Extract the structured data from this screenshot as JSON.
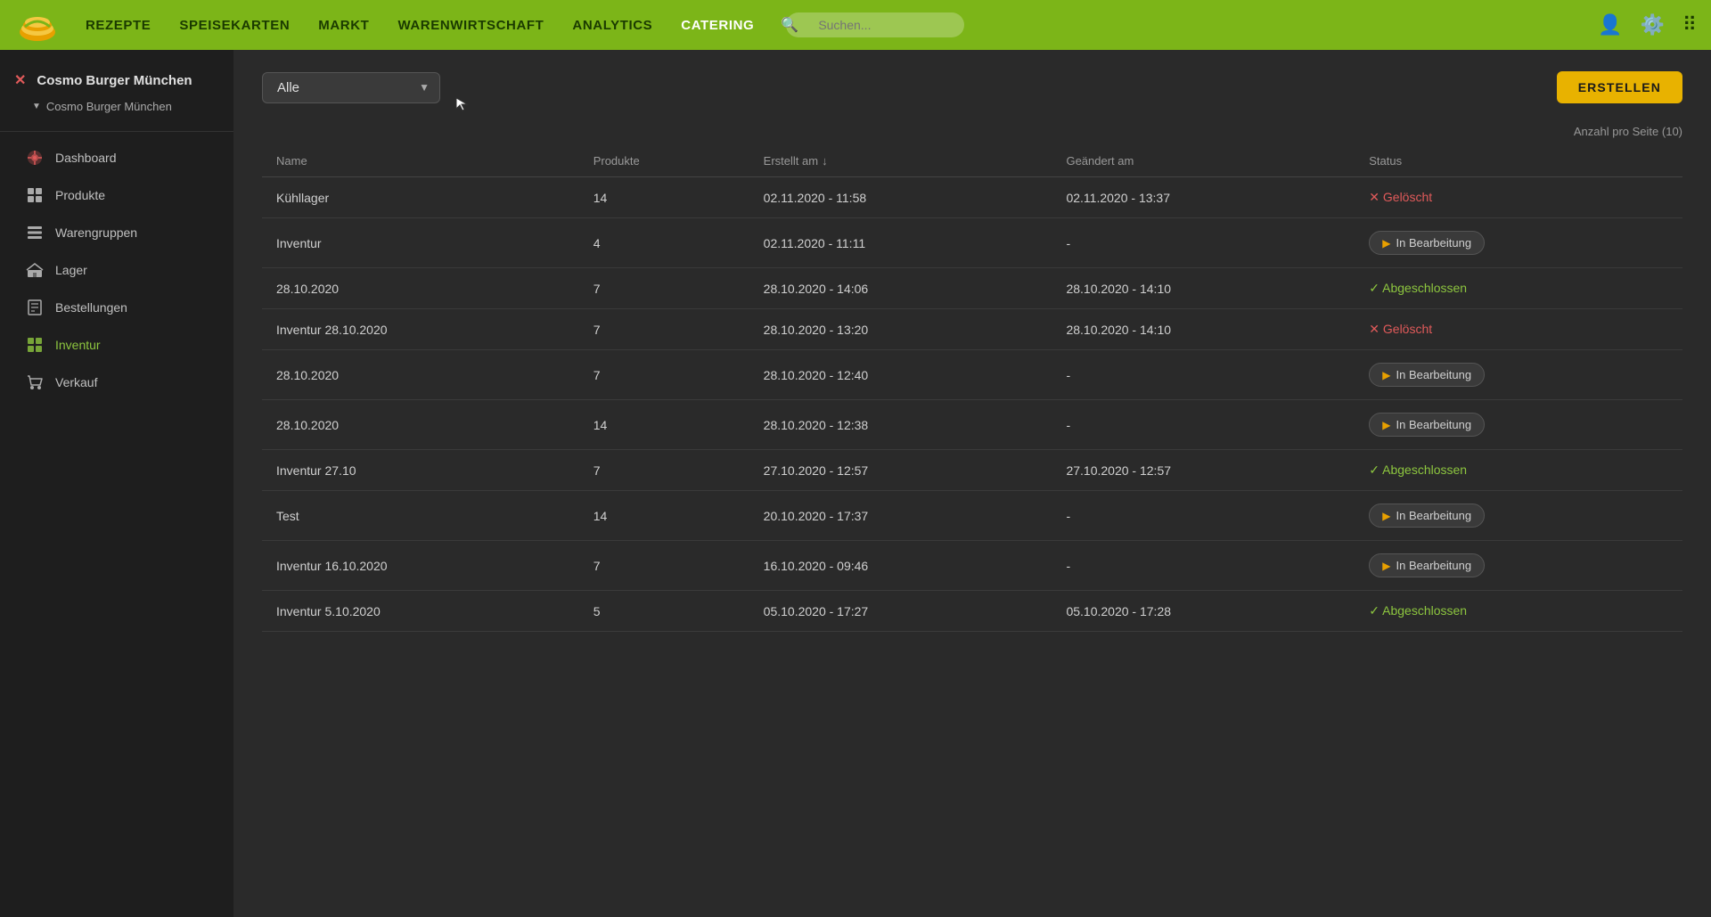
{
  "nav": {
    "items": [
      {
        "label": "REZEPTE",
        "active": false
      },
      {
        "label": "SPEISEKARTEN",
        "active": false
      },
      {
        "label": "MARKT",
        "active": false
      },
      {
        "label": "WARENWIRTSCHAFT",
        "active": false
      },
      {
        "label": "ANALYTICS",
        "active": false
      },
      {
        "label": "CATERING",
        "active": false
      }
    ],
    "search_placeholder": "Suchen..."
  },
  "sidebar": {
    "close_label": "✕",
    "company": "Cosmo Burger München",
    "sub_company": "Cosmo Burger München",
    "items": [
      {
        "label": "Dashboard",
        "icon": "dashboard",
        "active": false
      },
      {
        "label": "Produkte",
        "icon": "produkte",
        "active": false
      },
      {
        "label": "Warengruppen",
        "icon": "warengruppen",
        "active": false
      },
      {
        "label": "Lager",
        "icon": "lager",
        "active": false
      },
      {
        "label": "Bestellungen",
        "icon": "bestellungen",
        "active": false
      },
      {
        "label": "Inventur",
        "icon": "inventur",
        "active": true
      },
      {
        "label": "Verkauf",
        "icon": "verkauf",
        "active": false
      }
    ]
  },
  "main": {
    "filter_label": "Alle",
    "per_page": "Anzahl pro Seite (10)",
    "btn_erstellen": "ERSTELLEN",
    "table": {
      "columns": [
        "Name",
        "Produkte",
        "Erstellt am",
        "Geändert am",
        "Status"
      ],
      "rows": [
        {
          "name": "Kühllager",
          "produkte": "14",
          "erstellt": "02.11.2020 - 11:58",
          "geaendert": "02.11.2020 - 13:37",
          "status": "Gelöscht",
          "status_type": "geloescht"
        },
        {
          "name": "Inventur",
          "produkte": "4",
          "erstellt": "02.11.2020 - 11:11",
          "geaendert": "-",
          "status": "In Bearbeitung",
          "status_type": "inbearbeitung"
        },
        {
          "name": "28.10.2020",
          "produkte": "7",
          "erstellt": "28.10.2020 - 14:06",
          "geaendert": "28.10.2020 - 14:10",
          "status": "Abgeschlossen",
          "status_type": "abgeschlossen"
        },
        {
          "name": "Inventur 28.10.2020",
          "produkte": "7",
          "erstellt": "28.10.2020 - 13:20",
          "geaendert": "28.10.2020 - 14:10",
          "status": "Gelöscht",
          "status_type": "geloescht"
        },
        {
          "name": "28.10.2020",
          "produkte": "7",
          "erstellt": "28.10.2020 - 12:40",
          "geaendert": "-",
          "status": "In Bearbeitung",
          "status_type": "inbearbeitung"
        },
        {
          "name": "28.10.2020",
          "produkte": "14",
          "erstellt": "28.10.2020 - 12:38",
          "geaendert": "-",
          "status": "In Bearbeitung",
          "status_type": "inbearbeitung"
        },
        {
          "name": "Inventur 27.10",
          "produkte": "7",
          "erstellt": "27.10.2020 - 12:57",
          "geaendert": "27.10.2020 - 12:57",
          "status": "Abgeschlossen",
          "status_type": "abgeschlossen"
        },
        {
          "name": "Test",
          "produkte": "14",
          "erstellt": "20.10.2020 - 17:37",
          "geaendert": "-",
          "status": "In Bearbeitung",
          "status_type": "inbearbeitung"
        },
        {
          "name": "Inventur 16.10.2020",
          "produkte": "7",
          "erstellt": "16.10.2020 - 09:46",
          "geaendert": "-",
          "status": "In Bearbeitung",
          "status_type": "inbearbeitung"
        },
        {
          "name": "Inventur 5.10.2020",
          "produkte": "5",
          "erstellt": "05.10.2020 - 17:27",
          "geaendert": "05.10.2020 - 17:28",
          "status": "Abgeschlossen",
          "status_type": "abgeschlossen"
        }
      ]
    }
  }
}
